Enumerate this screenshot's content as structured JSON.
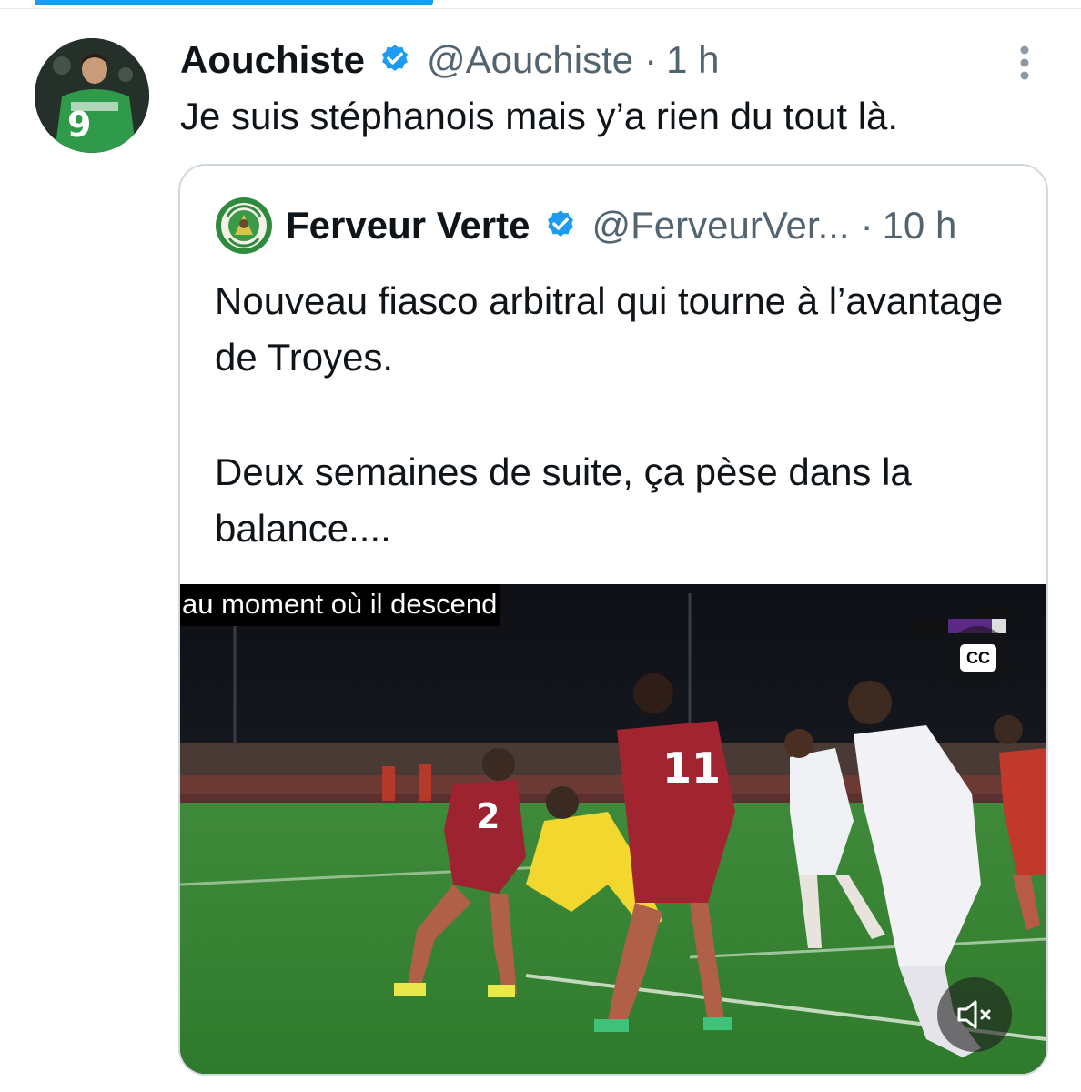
{
  "colors": {
    "accent": "#1d9bf0",
    "text_primary": "#0f1419",
    "text_secondary": "#536471",
    "border": "#cfd9de"
  },
  "tweet": {
    "author": {
      "display_name": "Aouchiste",
      "handle": "@Aouchiste",
      "verified": true,
      "avatar_icon": "avatar-icon"
    },
    "separator": "·",
    "time": "1 h",
    "text": "Je suis stéphanois mais y’a rien du tout là.",
    "more_icon": "more-vertical-icon",
    "quote": {
      "author": {
        "display_name": "Ferveur Verte",
        "handle": "@FerveurVer...",
        "verified": true,
        "avatar_icon": "ferveur-verte-logo-icon"
      },
      "separator": "·",
      "time": "10 h",
      "paragraphs": [
        "Nouveau fiasco arbitral qui tourne à l’avantage de Troyes.",
        "Deux semaines de suite, ça pèse dans la balance...."
      ],
      "media": {
        "type": "video",
        "caption": "au moment où il descend",
        "cc_label": "CC",
        "cc_icon": "closed-captions-icon",
        "mute_icon": "volume-muted-icon",
        "broadcaster_icon": "broadcaster-logo-icon"
      }
    }
  }
}
